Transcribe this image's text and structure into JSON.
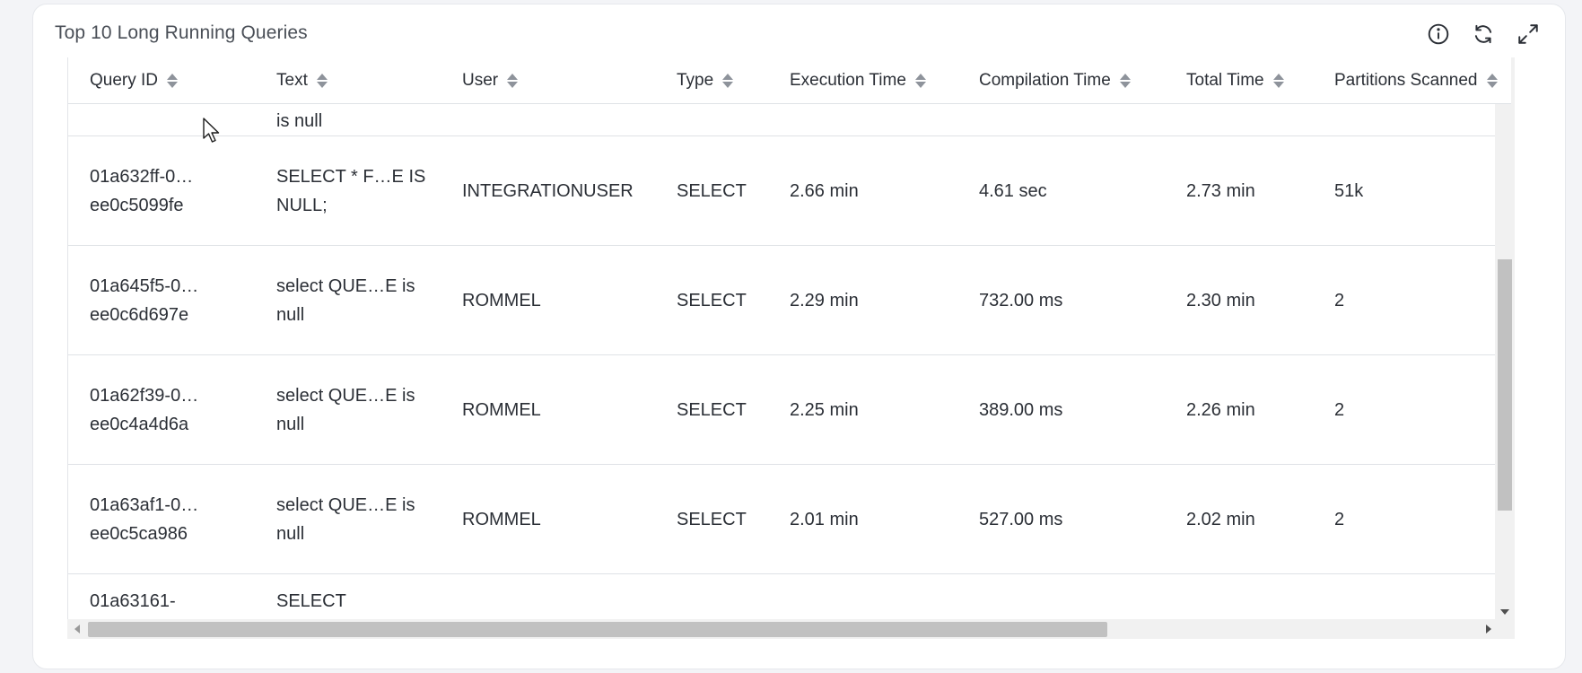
{
  "widget": {
    "title": "Top 10 Long Running Queries",
    "icons": [
      "info-icon",
      "refresh-icon",
      "expand-icon"
    ]
  },
  "table": {
    "columns": [
      "Query ID",
      "Text",
      "User",
      "Type",
      "Execution Time",
      "Compilation Time",
      "Total Time",
      "Partitions Scanned"
    ],
    "rows": [
      {
        "query_id": "",
        "text": "is null",
        "user": "",
        "type": "",
        "execution_time": "",
        "compilation_time": "",
        "total_time": "",
        "partitions_scanned": ""
      },
      {
        "query_id": "01a632ff-0…ee0c5099fe",
        "text": "SELECT * F…E IS NULL;",
        "user": "INTEGRATIONUSER",
        "type": "SELECT",
        "execution_time": "2.66 min",
        "compilation_time": "4.61 sec",
        "total_time": "2.73 min",
        "partitions_scanned": "51k"
      },
      {
        "query_id": "01a645f5-0…ee0c6d697e",
        "text": "select QUE…E is null",
        "user": "ROMMEL",
        "type": "SELECT",
        "execution_time": "2.29 min",
        "compilation_time": "732.00 ms",
        "total_time": "2.30 min",
        "partitions_scanned": "2"
      },
      {
        "query_id": "01a62f39-0…ee0c4a4d6a",
        "text": "select QUE…E is null",
        "user": "ROMMEL",
        "type": "SELECT",
        "execution_time": "2.25 min",
        "compilation_time": "389.00 ms",
        "total_time": "2.26 min",
        "partitions_scanned": "2"
      },
      {
        "query_id": "01a63af1-0…ee0c5ca986",
        "text": "select QUE…E is null",
        "user": "ROMMEL",
        "type": "SELECT",
        "execution_time": "2.01 min",
        "compilation_time": "527.00 ms",
        "total_time": "2.02 min",
        "partitions_scanned": "2"
      },
      {
        "query_id": "01a63161-",
        "text": "SELECT",
        "user": "",
        "type": "",
        "execution_time": "",
        "compilation_time": "",
        "total_time": "",
        "partitions_scanned": ""
      }
    ]
  },
  "colors": {
    "page_bg": "#f3f4f7",
    "card_bg": "#ffffff",
    "text": "#2b2f36",
    "muted": "#4a4f57",
    "scrollbar_thumb": "#c1c1c1"
  }
}
